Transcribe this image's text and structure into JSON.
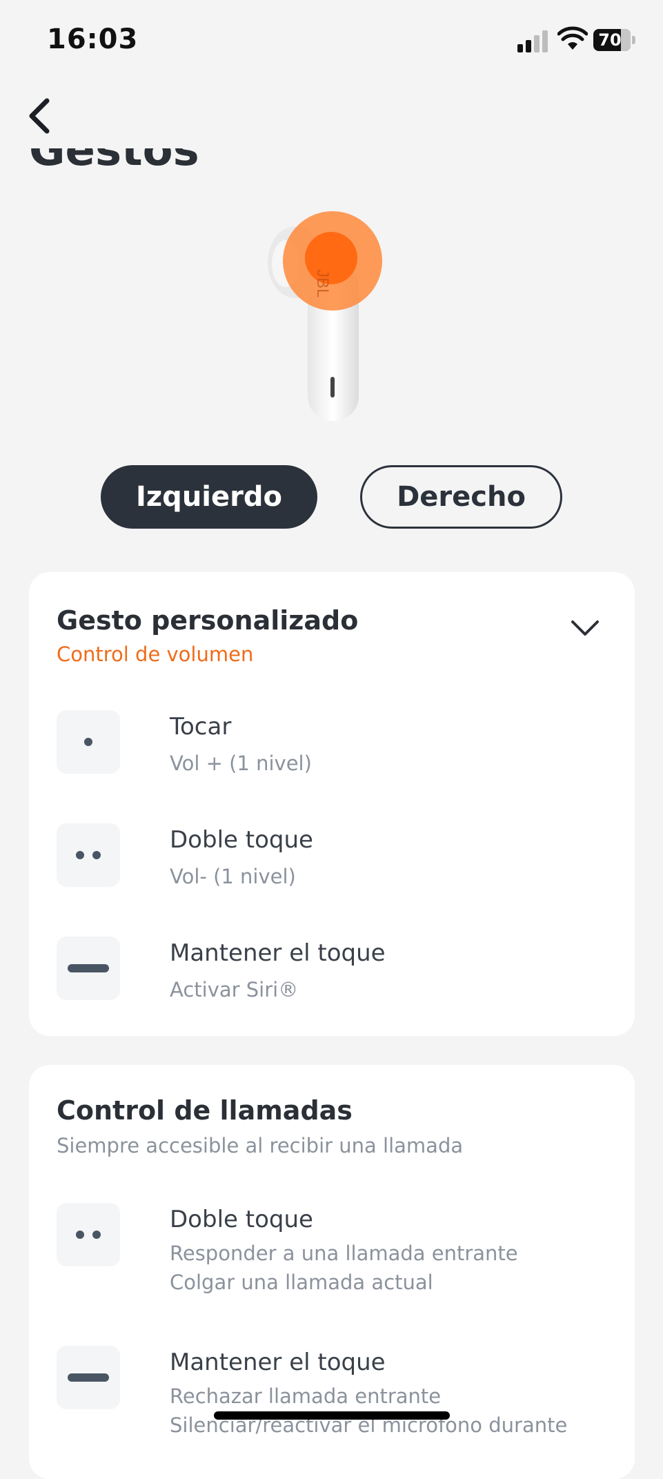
{
  "status_bar": {
    "time": "16:03",
    "battery": "70"
  },
  "header": {
    "title": "Gestos",
    "back_icon": "chevron-left-icon"
  },
  "earbud": {
    "brand": "JBL",
    "highlight_color": "#ff6a13"
  },
  "side_toggle": {
    "left_label": "Izquierdo",
    "right_label": "Derecho",
    "selected": "Izquierdo"
  },
  "custom_gesture": {
    "title": "Gesto personalizado",
    "subtitle": "Control de volumen",
    "subtitle_color": "#ef6c1a",
    "expand_icon": "chevron-down-icon",
    "rows": [
      {
        "icon": "single-tap-icon",
        "title": "Tocar",
        "lines": [
          "Vol + (1 nivel)"
        ]
      },
      {
        "icon": "double-tap-icon",
        "title": "Doble toque",
        "lines": [
          "Vol- (1 nivel)"
        ]
      },
      {
        "icon": "hold-icon",
        "title": "Mantener el toque",
        "lines": [
          "Activar Siri®"
        ]
      }
    ]
  },
  "call_control": {
    "title": "Control de llamadas",
    "subtitle": "Siempre accesible al recibir una llamada",
    "rows": [
      {
        "icon": "double-tap-icon",
        "title": "Doble toque",
        "lines": [
          "Responder a una llamada entrante",
          "Colgar una llamada actual"
        ]
      },
      {
        "icon": "hold-icon",
        "title": "Mantener el toque",
        "lines": [
          "Rechazar llamada entrante",
          "Silenciar/reactivar el micrófono durante"
        ]
      }
    ]
  }
}
